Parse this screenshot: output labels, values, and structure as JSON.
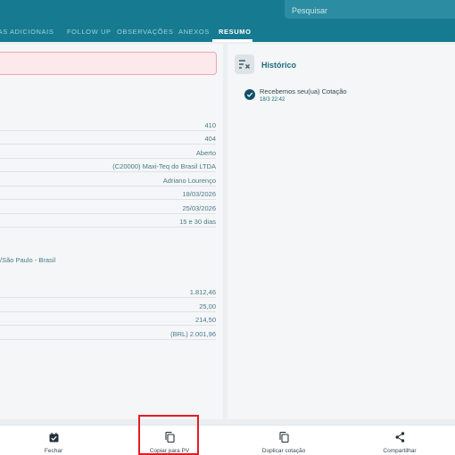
{
  "search": {
    "placeholder": "Pesquisar"
  },
  "tabs": [
    {
      "label": "SAS ADICIONAIS"
    },
    {
      "label": "FOLLOW UP"
    },
    {
      "label": "OBSERVAÇÕES"
    },
    {
      "label": "ANEXOS"
    },
    {
      "label": "RESUMO",
      "active": true
    }
  ],
  "summary": {
    "rows": [
      "410",
      "404",
      "Aberto",
      "(C20000) Maxi-Teq do Brasil LTDA",
      "Adriano Lourenço",
      "18/03/2026",
      "25/03/2026",
      "15 e 30 dias"
    ],
    "address": "/São Paulo - Brasil",
    "totals": [
      "1.812,46",
      "25,00",
      "214,50",
      "(BRL) 2.001,96"
    ]
  },
  "history": {
    "title": "Histórico",
    "events": [
      {
        "text": "Recebemos seu(ua) Cotação",
        "time": "18/3 22:42"
      }
    ]
  },
  "bottom_bar": {
    "close": "Fechar",
    "copy_pv": "Copiar para PV",
    "duplicate": "Duplicar cotação",
    "share": "Compartilhar"
  },
  "colors": {
    "primary": "#167a90",
    "highlight": "#e41c23",
    "alert_bg": "#fbe9ec"
  }
}
